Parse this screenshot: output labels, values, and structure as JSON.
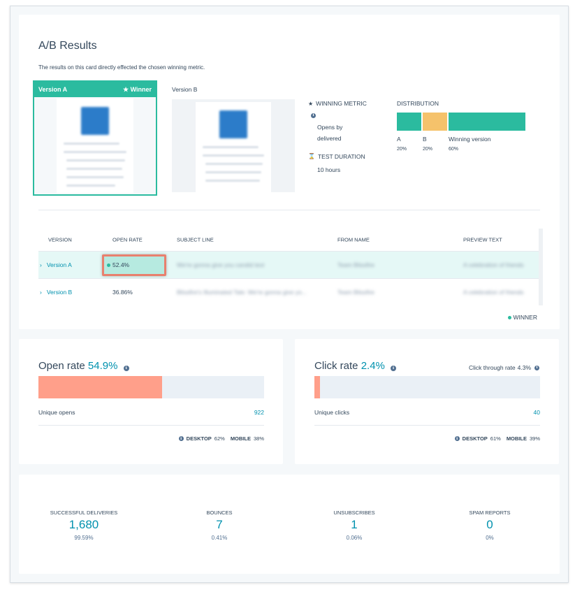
{
  "ab": {
    "title": "A/B Results",
    "description": "The results on this card directly effected the chosen winning metric.",
    "version_a_label": "Version A",
    "winner_label": "Winner",
    "version_b_label": "Version B",
    "winning_metric_label": "WINNING METRIC",
    "winning_metric_value_line1": "Opens by",
    "winning_metric_value_line2": "delivered",
    "test_duration_label": "TEST DURATION",
    "test_duration_value": "10 hours",
    "distribution": {
      "label": "DISTRIBUTION",
      "segments": [
        {
          "name": "A",
          "pct": "20%",
          "fraction": 0.2,
          "color": "#2bbb9f"
        },
        {
          "name": "B",
          "pct": "20%",
          "fraction": 0.2,
          "color": "#f5c26b"
        },
        {
          "name": "Winning version",
          "pct": "60%",
          "fraction": 0.6,
          "color": "#2bbb9f"
        }
      ]
    }
  },
  "table": {
    "headers": [
      "VERSION",
      "OPEN RATE",
      "SUBJECT LINE",
      "FROM NAME",
      "PREVIEW TEXT"
    ],
    "rows": [
      {
        "version": "Version A",
        "open_rate": "52.4%",
        "subject": "We're gonna give you candid text",
        "from": "Team Blissfire",
        "preview": "A celebration of friends"
      },
      {
        "version": "Version B",
        "open_rate": "36.86%",
        "subject": "Blissfire's Illuminated Tale: We're gonna give yo...",
        "from": "Team Blissfire",
        "preview": "A celebration of friends"
      }
    ],
    "winner_legend": "WINNER"
  },
  "open_rate": {
    "title": "Open rate",
    "value": "54.9%",
    "fraction": 0.549,
    "bar_color": "#ff9f8a",
    "metric_label": "Unique opens",
    "metric_value": "922",
    "desktop_label": "DESKTOP",
    "desktop_value": "62%",
    "mobile_label": "MOBILE",
    "mobile_value": "38%"
  },
  "click_rate": {
    "title": "Click rate",
    "value": "2.4%",
    "fraction": 0.024,
    "bar_color": "#ff9f8a",
    "ctr_label": "Click through rate",
    "ctr_value": "4.3%",
    "metric_label": "Unique clicks",
    "metric_value": "40",
    "desktop_label": "DESKTOP",
    "desktop_value": "61%",
    "mobile_label": "MOBILE",
    "mobile_value": "39%"
  },
  "stats": [
    {
      "label": "SUCCESSFUL DELIVERIES",
      "value": "1,680",
      "pct": "99.59%"
    },
    {
      "label": "BOUNCES",
      "value": "7",
      "pct": "0.41%"
    },
    {
      "label": "UNSUBSCRIBES",
      "value": "1",
      "pct": "0.06%"
    },
    {
      "label": "SPAM REPORTS",
      "value": "0",
      "pct": "0%"
    }
  ],
  "colors": {
    "accent": "#0091ae",
    "teal": "#2bbb9f",
    "coral": "#ff9f8a",
    "highlight_border": "#e8806e"
  }
}
